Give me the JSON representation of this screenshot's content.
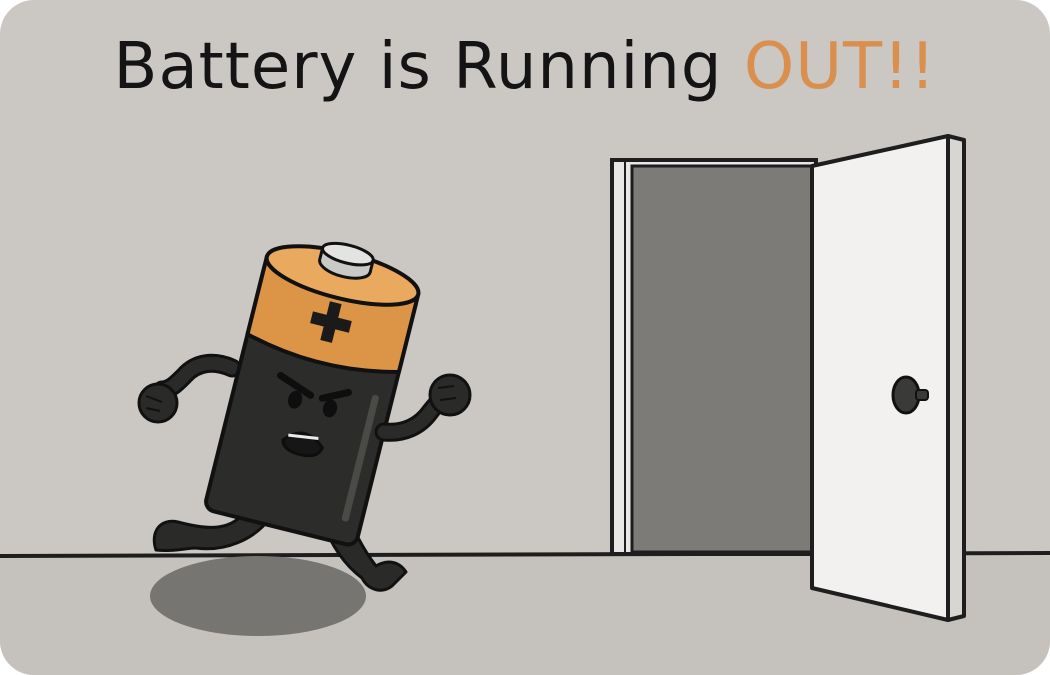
{
  "title": {
    "main": "Battery is Running ",
    "accent": "OUT!!"
  },
  "colors": {
    "background": "#cbc8c4",
    "floor": "#c5c2be",
    "accent": "#d9904e",
    "battery_body": "#2c2c2a",
    "battery_top": "#dc9447",
    "door": "#f2f1ef",
    "doorway": "#7d7b78"
  },
  "battery": {
    "terminal_symbol": "+",
    "expression": "angry"
  },
  "icons": [
    "battery-character-icon",
    "open-door-icon",
    "door-knob-icon"
  ]
}
